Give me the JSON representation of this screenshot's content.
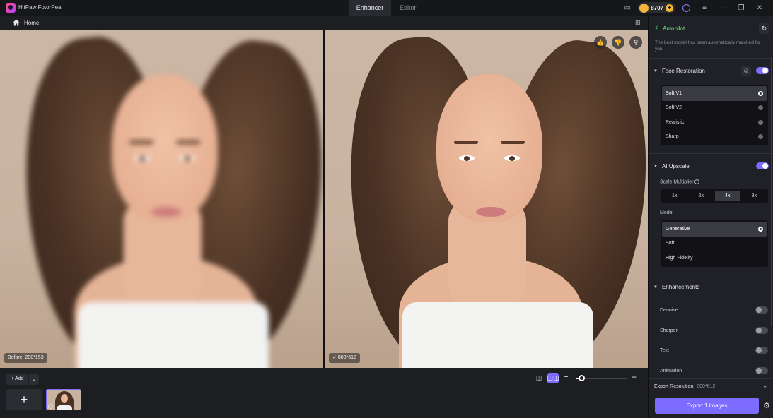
{
  "app": {
    "title": "HitPaw FotorPea"
  },
  "tabs": [
    {
      "label": "Enhancer",
      "active": true
    },
    {
      "label": "Editor",
      "active": false
    }
  ],
  "titlebar": {
    "credits": "8707"
  },
  "subheader": {
    "home_label": "Home"
  },
  "canvas": {
    "before_label": "Before: 200*153",
    "after_label": "800*612",
    "tools": [
      "thumbs-up-icon",
      "thumbs-down-icon",
      "zoom-icon"
    ]
  },
  "bottom": {
    "add_label": "Add",
    "new_tile": "+",
    "zoom_level_fraction": 0.1
  },
  "panel": {
    "autopilot": {
      "title": "Autopilot",
      "description": "The best model has been automatically matched for you"
    },
    "face_restoration": {
      "title": "Face Restoration",
      "enabled": true,
      "options": [
        {
          "label": "Soft V1",
          "selected": true
        },
        {
          "label": "Soft V2",
          "selected": false
        },
        {
          "label": "Realistic",
          "selected": false
        },
        {
          "label": "Sharp",
          "selected": false
        }
      ]
    },
    "ai_upscale": {
      "title": "AI Upscale",
      "enabled": true,
      "scale_label": "Scale Multiplier",
      "scales": [
        {
          "label": "1x",
          "selected": false
        },
        {
          "label": "2x",
          "selected": false
        },
        {
          "label": "4x",
          "selected": true
        },
        {
          "label": "8x",
          "selected": false
        }
      ],
      "model_label": "Model",
      "models": [
        {
          "label": "Generative",
          "selected": true
        },
        {
          "label": "Soft",
          "selected": false
        },
        {
          "label": "High Fidelity",
          "selected": false
        }
      ]
    },
    "enhancements": {
      "title": "Enhancements",
      "items": [
        {
          "label": "Denoise",
          "enabled": false
        },
        {
          "label": "Sharpen",
          "enabled": false
        },
        {
          "label": "Text",
          "enabled": false
        },
        {
          "label": "Animation",
          "enabled": false
        }
      ]
    },
    "export": {
      "resolution_label": "Export Resolution:",
      "resolution_value": "800*612",
      "button_label": "Export 1 images"
    }
  },
  "colors": {
    "accent": "#7c6cff",
    "autopilot_green": "#6ee47e",
    "credit_gold": "#f4b63a"
  }
}
